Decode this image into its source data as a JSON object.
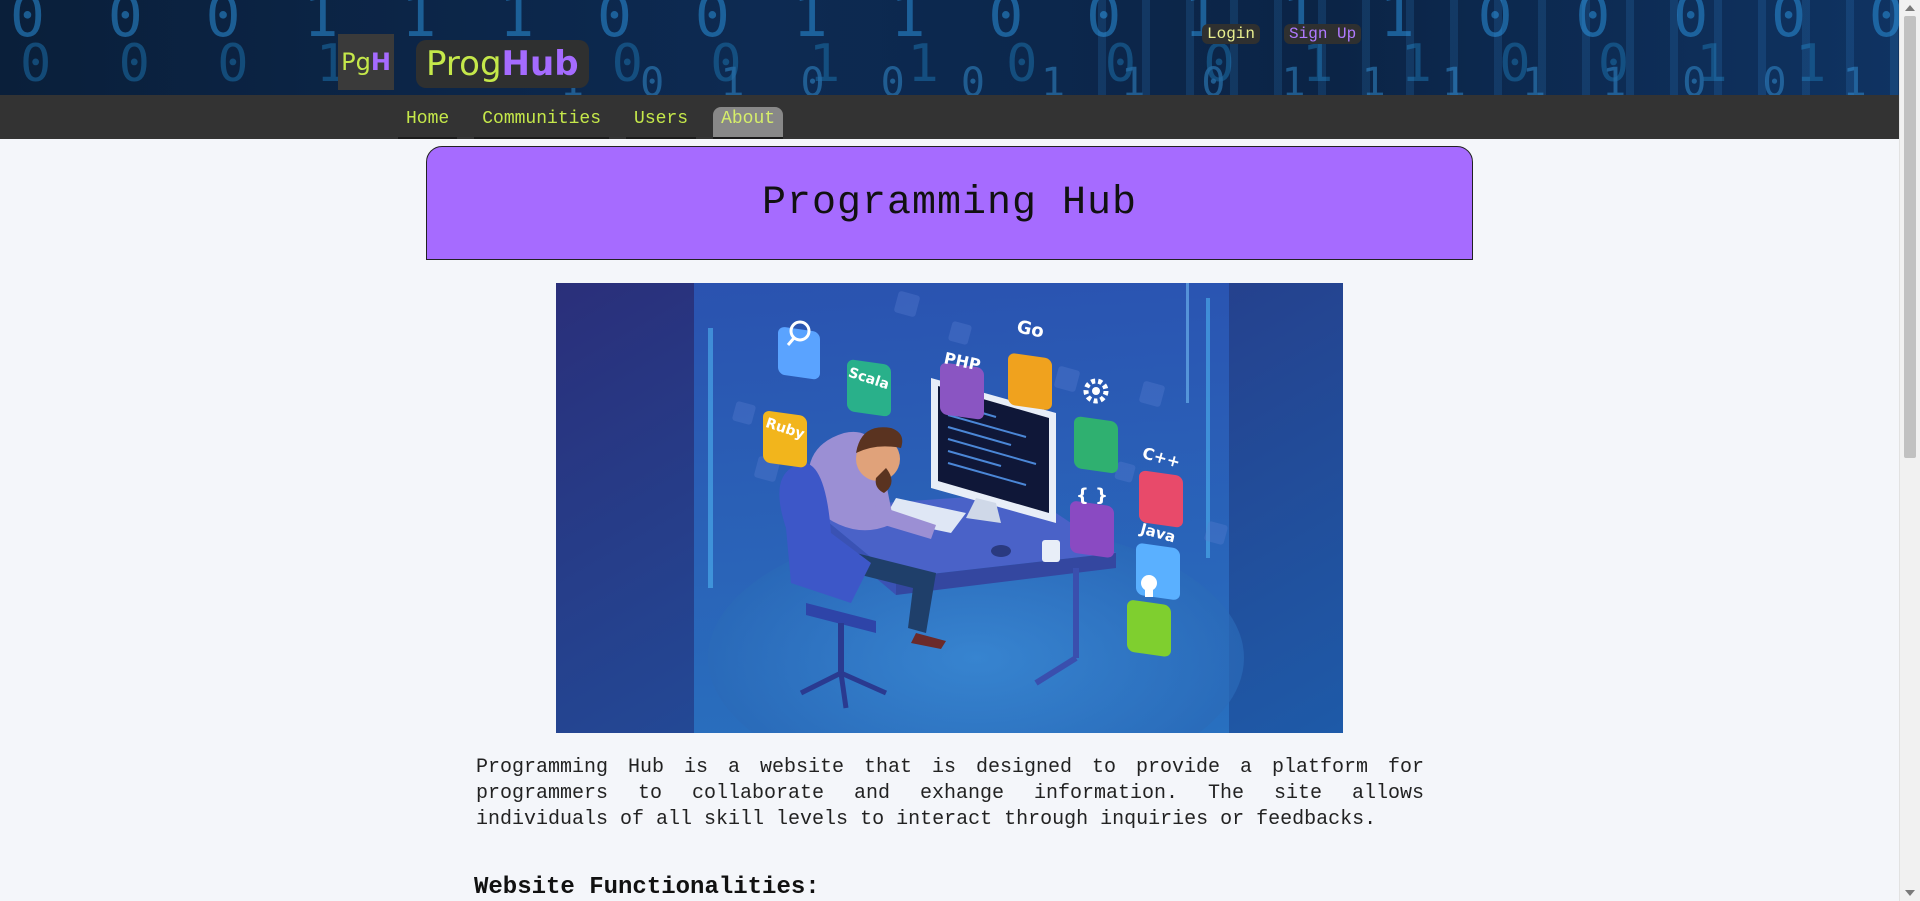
{
  "header": {
    "logo_left": "Pg",
    "logo_right": "H",
    "brand_left": "Prog",
    "brand_right": "Hub",
    "login_label": "Login",
    "signup_label": "Sign Up",
    "binary_row1": "0 0 0 1 1 1 0 0 1 1 0 0 1 1 1 0 0 0 0 0 1 1 0 1 1 1 0 0 1",
    "binary_row2": "0 0 0 1 1 1 0 0 1 1 0 0 0 1 1 0 0 1 1 1 1 0 1 1 1 0 0 1 1",
    "binary_row3": "1 0 1 0 0 0 1 1 0 1 1 1 1 1 0 0 1"
  },
  "nav": {
    "items": [
      {
        "label": "Home"
      },
      {
        "label": "Communities"
      },
      {
        "label": "Users"
      },
      {
        "label": "About"
      }
    ],
    "active": "About"
  },
  "hero": {
    "title": "Programming Hub"
  },
  "illustration": {
    "badges": [
      "Scala",
      "PHP",
      "Go",
      "Ruby",
      "C++",
      "{ }",
      "Java"
    ]
  },
  "content": {
    "description": "Programming Hub is a website that is designed to provide a platform for programmers to collaborate and exhange information. The site allows individuals of all skill levels to interact through inquiries or feedbacks.",
    "section_title": "Website Functionalities:"
  },
  "colors": {
    "accent_green": "#c5e84a",
    "accent_purple": "#a66bff",
    "nav_bg": "#333333",
    "page_bg": "#f4f6fa"
  }
}
